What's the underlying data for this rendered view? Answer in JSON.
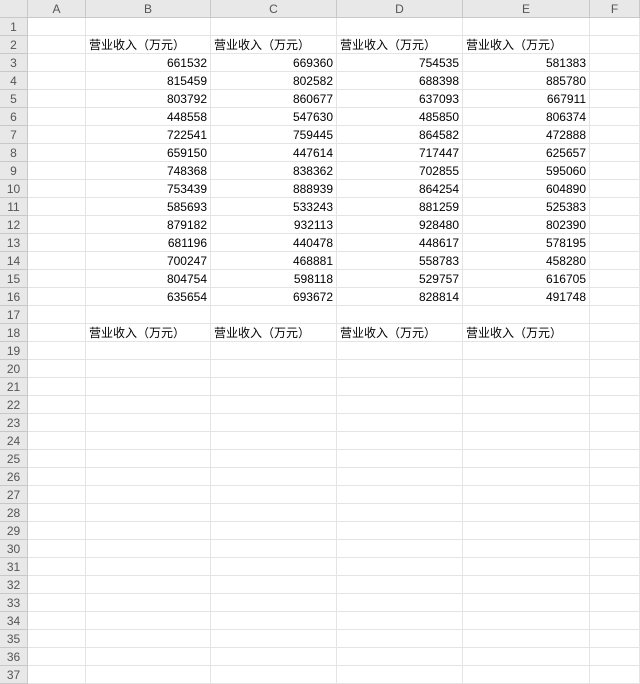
{
  "columns": [
    "A",
    "B",
    "C",
    "D",
    "E",
    "F"
  ],
  "rowCount": 37,
  "hdrLabel": "营业收入（万元）",
  "chart_data": {
    "type": "table",
    "title": "",
    "headers_row2": [
      "营业收入（万元）",
      "营业收入（万元）",
      "营业收入（万元）",
      "营业收入（万元）"
    ],
    "headers_row18": [
      "营业收入（万元）",
      "营业收入（万元）",
      "营业收入（万元）",
      "营业收入（万元）"
    ],
    "values_rows3_to_16": [
      [
        661532,
        669360,
        754535,
        581383
      ],
      [
        815459,
        802582,
        688398,
        885780
      ],
      [
        803792,
        860677,
        637093,
        667911
      ],
      [
        448558,
        547630,
        485850,
        806374
      ],
      [
        722541,
        759445,
        864582,
        472888
      ],
      [
        659150,
        447614,
        717447,
        625657
      ],
      [
        748368,
        838362,
        702855,
        595060
      ],
      [
        753439,
        888939,
        864254,
        604890
      ],
      [
        585693,
        533243,
        881259,
        525383
      ],
      [
        879182,
        932113,
        928480,
        802390
      ],
      [
        681196,
        440478,
        448617,
        578195
      ],
      [
        700247,
        468881,
        558783,
        458280
      ],
      [
        804754,
        598118,
        529757,
        616705
      ],
      [
        635654,
        693672,
        828814,
        491748
      ]
    ]
  },
  "cells": {
    "r2": {
      "B": "营业收入（万元）",
      "C": "营业收入（万元）",
      "D": "营业收入（万元）",
      "E": "营业收入（万元）"
    },
    "r3": {
      "B": "661532",
      "C": "669360",
      "D": "754535",
      "E": "581383"
    },
    "r4": {
      "B": "815459",
      "C": "802582",
      "D": "688398",
      "E": "885780"
    },
    "r5": {
      "B": "803792",
      "C": "860677",
      "D": "637093",
      "E": "667911"
    },
    "r6": {
      "B": "448558",
      "C": "547630",
      "D": "485850",
      "E": "806374"
    },
    "r7": {
      "B": "722541",
      "C": "759445",
      "D": "864582",
      "E": "472888"
    },
    "r8": {
      "B": "659150",
      "C": "447614",
      "D": "717447",
      "E": "625657"
    },
    "r9": {
      "B": "748368",
      "C": "838362",
      "D": "702855",
      "E": "595060"
    },
    "r10": {
      "B": "753439",
      "C": "888939",
      "D": "864254",
      "E": "604890"
    },
    "r11": {
      "B": "585693",
      "C": "533243",
      "D": "881259",
      "E": "525383"
    },
    "r12": {
      "B": "879182",
      "C": "932113",
      "D": "928480",
      "E": "802390"
    },
    "r13": {
      "B": "681196",
      "C": "440478",
      "D": "448617",
      "E": "578195"
    },
    "r14": {
      "B": "700247",
      "C": "468881",
      "D": "558783",
      "E": "458280"
    },
    "r15": {
      "B": "804754",
      "C": "598118",
      "D": "529757",
      "E": "616705"
    },
    "r16": {
      "B": "635654",
      "C": "693672",
      "D": "828814",
      "E": "491748"
    },
    "r18": {
      "B": "营业收入（万元）",
      "C": "营业收入（万元）",
      "D": "营业收入（万元）",
      "E": "营业收入（万元）"
    }
  },
  "textRows": [
    2,
    18
  ]
}
